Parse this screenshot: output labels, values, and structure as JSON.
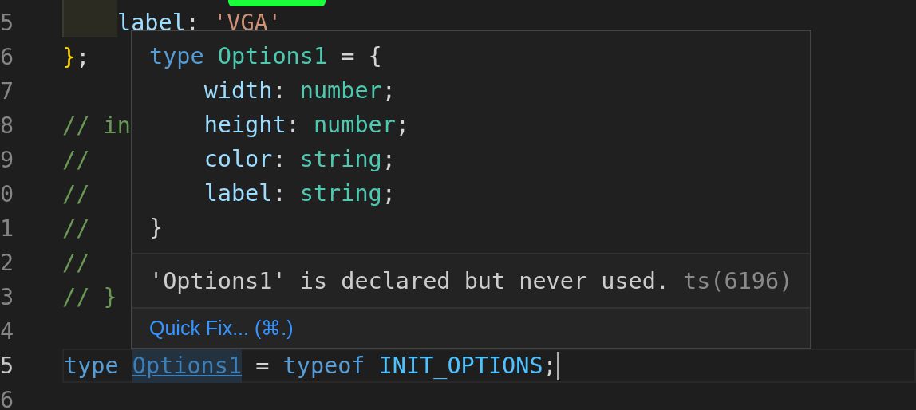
{
  "editor": {
    "lines": [
      {
        "number": "5",
        "indent_highlight": true,
        "current": false,
        "tokens": [
          {
            "text": "label",
            "kind": "property"
          },
          {
            "text": ":",
            "kind": "punct"
          },
          {
            "text": "'VGA'",
            "kind": "string",
            "space": true
          }
        ]
      },
      {
        "number": "6",
        "current": false,
        "tokens": [
          {
            "text": "}",
            "kind": "brace"
          },
          {
            "text": ";",
            "kind": "punct"
          }
        ]
      },
      {
        "number": "7",
        "current": false
      },
      {
        "number": "8",
        "current": false,
        "tokens": [
          {
            "text": "// in",
            "kind": "comment"
          }
        ]
      },
      {
        "number": "9",
        "current": false,
        "tokens": [
          {
            "text": "//",
            "kind": "comment"
          }
        ]
      },
      {
        "number": "0",
        "current": false,
        "tokens": [
          {
            "text": "//",
            "kind": "comment"
          }
        ]
      },
      {
        "number": "1",
        "current": false,
        "tokens": [
          {
            "text": "//",
            "kind": "comment"
          }
        ]
      },
      {
        "number": "2",
        "current": false,
        "tokens": [
          {
            "text": "//",
            "kind": "comment"
          }
        ]
      },
      {
        "number": "3",
        "current": false,
        "tokens": [
          {
            "text": "// }",
            "kind": "comment"
          }
        ]
      },
      {
        "number": "4",
        "current": false
      },
      {
        "number": "5",
        "current": true,
        "tokens": [
          {
            "text": "type",
            "kind": "keyword"
          },
          {
            "text": "Options1",
            "kind": "typename",
            "link": true,
            "space": true
          },
          {
            "text": "=",
            "kind": "punct",
            "space": true
          },
          {
            "text": "typeof",
            "kind": "keyword",
            "space": true
          },
          {
            "text": "INIT_OPTIONS",
            "kind": "constant",
            "space": true
          },
          {
            "text": ";",
            "kind": "punct"
          }
        ]
      },
      {
        "number": "6",
        "current": false
      }
    ]
  },
  "hover": {
    "code": [
      {
        "indent": false,
        "tokens": [
          {
            "text": "type",
            "kind": "keyword"
          },
          {
            "text": "Options1",
            "kind": "type",
            "space": true
          },
          {
            "text": "= {",
            "kind": "punct",
            "space": true
          }
        ]
      },
      {
        "indent": true,
        "tokens": [
          {
            "text": "width",
            "kind": "property"
          },
          {
            "text": ":",
            "kind": "punct"
          },
          {
            "text": "number",
            "kind": "type",
            "space": true
          },
          {
            "text": ";",
            "kind": "punct"
          }
        ]
      },
      {
        "indent": true,
        "tokens": [
          {
            "text": "height",
            "kind": "property"
          },
          {
            "text": ":",
            "kind": "punct"
          },
          {
            "text": "number",
            "kind": "type",
            "space": true
          },
          {
            "text": ";",
            "kind": "punct"
          }
        ]
      },
      {
        "indent": true,
        "tokens": [
          {
            "text": "color",
            "kind": "property"
          },
          {
            "text": ":",
            "kind": "punct"
          },
          {
            "text": "string",
            "kind": "type",
            "space": true
          },
          {
            "text": ";",
            "kind": "punct"
          }
        ]
      },
      {
        "indent": true,
        "tokens": [
          {
            "text": "label",
            "kind": "property"
          },
          {
            "text": ":",
            "kind": "punct"
          },
          {
            "text": "string",
            "kind": "type",
            "space": true
          },
          {
            "text": ";",
            "kind": "punct"
          }
        ]
      },
      {
        "indent": false,
        "tokens": [
          {
            "text": "}",
            "kind": "punct"
          }
        ]
      }
    ],
    "message": "'Options1' is declared but never used.",
    "code_ref": "ts(6196)",
    "action": "Quick Fix... (⌘.)"
  }
}
